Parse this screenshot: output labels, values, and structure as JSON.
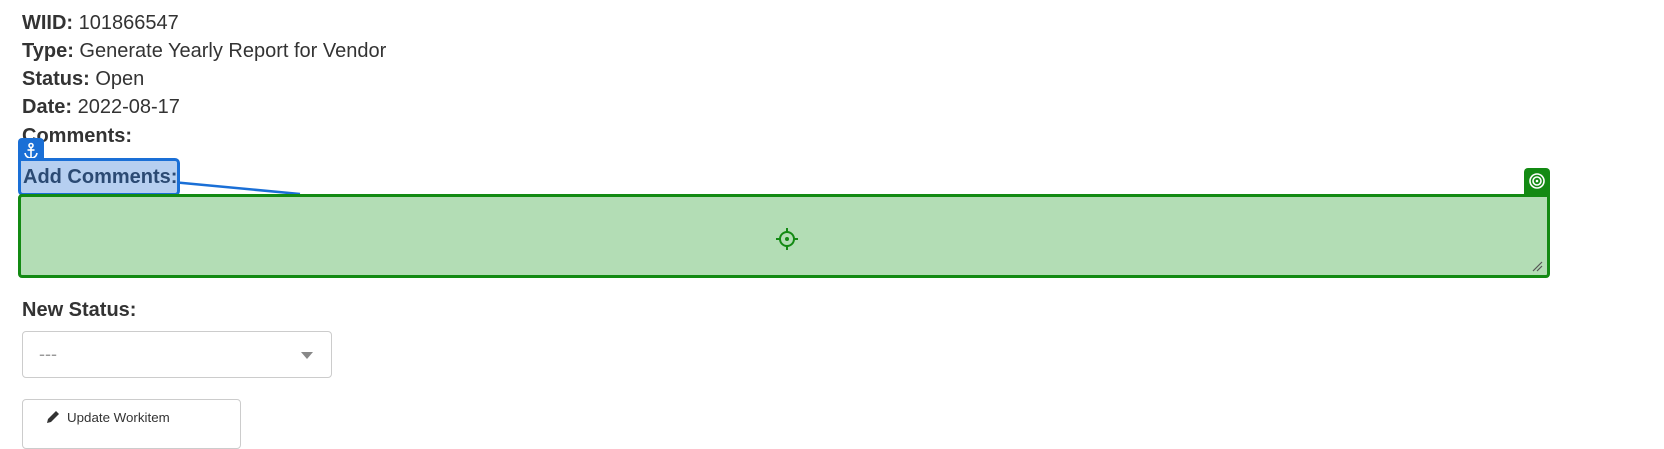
{
  "workitem": {
    "wiid_label": "WIID:",
    "wiid_value": "101866547",
    "type_label": "Type:",
    "type_value": "Generate Yearly Report for Vendor",
    "status_label": "Status:",
    "status_value": "Open",
    "date_label": "Date:",
    "date_value": "2022-08-17",
    "comments_label": "Comments:"
  },
  "form": {
    "add_comments_label": "Add Comments:",
    "comments_value": "",
    "new_status_label": "New Status:",
    "new_status_selected": "---",
    "update_button_label": "Update Workitem"
  },
  "overlay": {
    "anchor_icon": "anchor-icon",
    "target_icon": "target-icon",
    "crosshair_icon": "crosshair-icon",
    "anchor_color": "#1a6fd6",
    "target_color": "#138a13"
  }
}
